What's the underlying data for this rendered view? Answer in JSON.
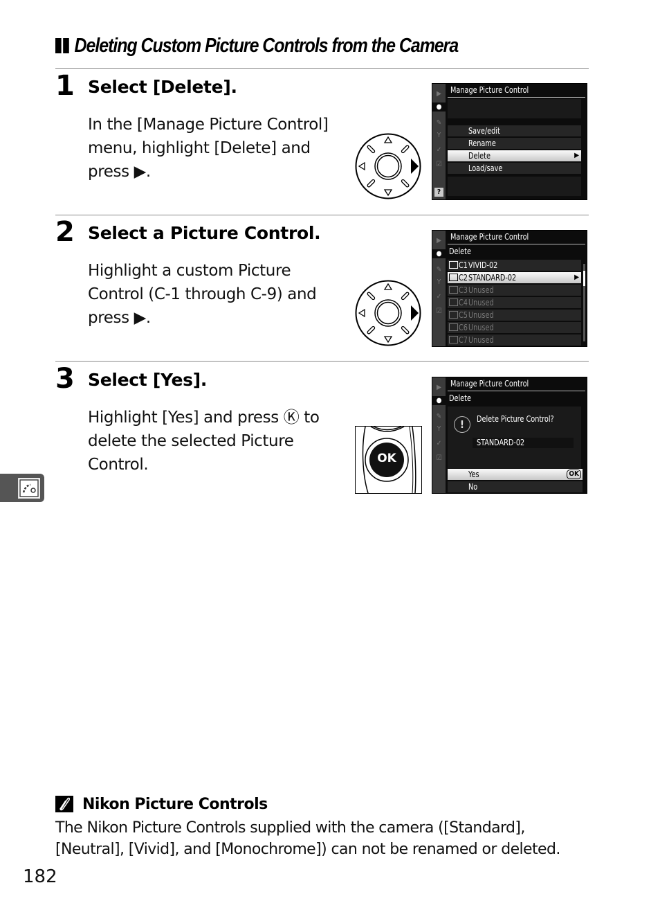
{
  "section": {
    "title": "Deleting Custom Picture Controls from the Camera",
    "title_icon": "double-bar-marker"
  },
  "steps": [
    {
      "number": "1",
      "title": "Select [Delete].",
      "body": "In the [Manage Picture Control] menu, highlight [Delete] and press ▶.",
      "control_icon": "multi-selector-right-icon",
      "screen": {
        "header": "Manage Picture Control",
        "items": [
          "Save/edit",
          "Rename",
          "Delete",
          "Load/save"
        ],
        "selected": "Delete"
      }
    },
    {
      "number": "2",
      "title": "Select a Picture Control.",
      "body": "Highlight a custom Picture Control (C-1 through C-9) and press ▶.",
      "control_icon": "multi-selector-right-icon",
      "screen": {
        "header": "Manage Picture Control",
        "subheader": "Delete",
        "items": [
          {
            "slot": "C1",
            "name": "VIVID-02",
            "used": true
          },
          {
            "slot": "C2",
            "name": "STANDARD-02",
            "used": true,
            "selected": true
          },
          {
            "slot": "C3",
            "name": "Unused",
            "used": false
          },
          {
            "slot": "C4",
            "name": "Unused",
            "used": false
          },
          {
            "slot": "C5",
            "name": "Unused",
            "used": false
          },
          {
            "slot": "C6",
            "name": "Unused",
            "used": false
          },
          {
            "slot": "C7",
            "name": "Unused",
            "used": false
          }
        ]
      }
    },
    {
      "number": "3",
      "title": "Select [Yes].",
      "body": "Highlight [Yes] and press Ⓚ to delete the selected Picture Control.",
      "control_icon": "ok-button-icon",
      "control_label": "OK",
      "screen": {
        "header": "Manage Picture Control",
        "subheader": "Delete",
        "question": "Delete Picture Control?",
        "target": "STANDARD-02",
        "options": [
          "Yes",
          "No"
        ],
        "selected": "Yes",
        "ok_badge": "OK"
      }
    }
  ],
  "sidebar_tab": {
    "icon": "picture-control-icon"
  },
  "note": {
    "icon": "pencil-note-icon",
    "title": "Nikon Picture Controls",
    "body": "The Nikon Picture Controls supplied with the camera ([Standard], [Neutral], [Vivid], and [Monochrome]) can not be renamed or deleted."
  },
  "page_number": "182"
}
